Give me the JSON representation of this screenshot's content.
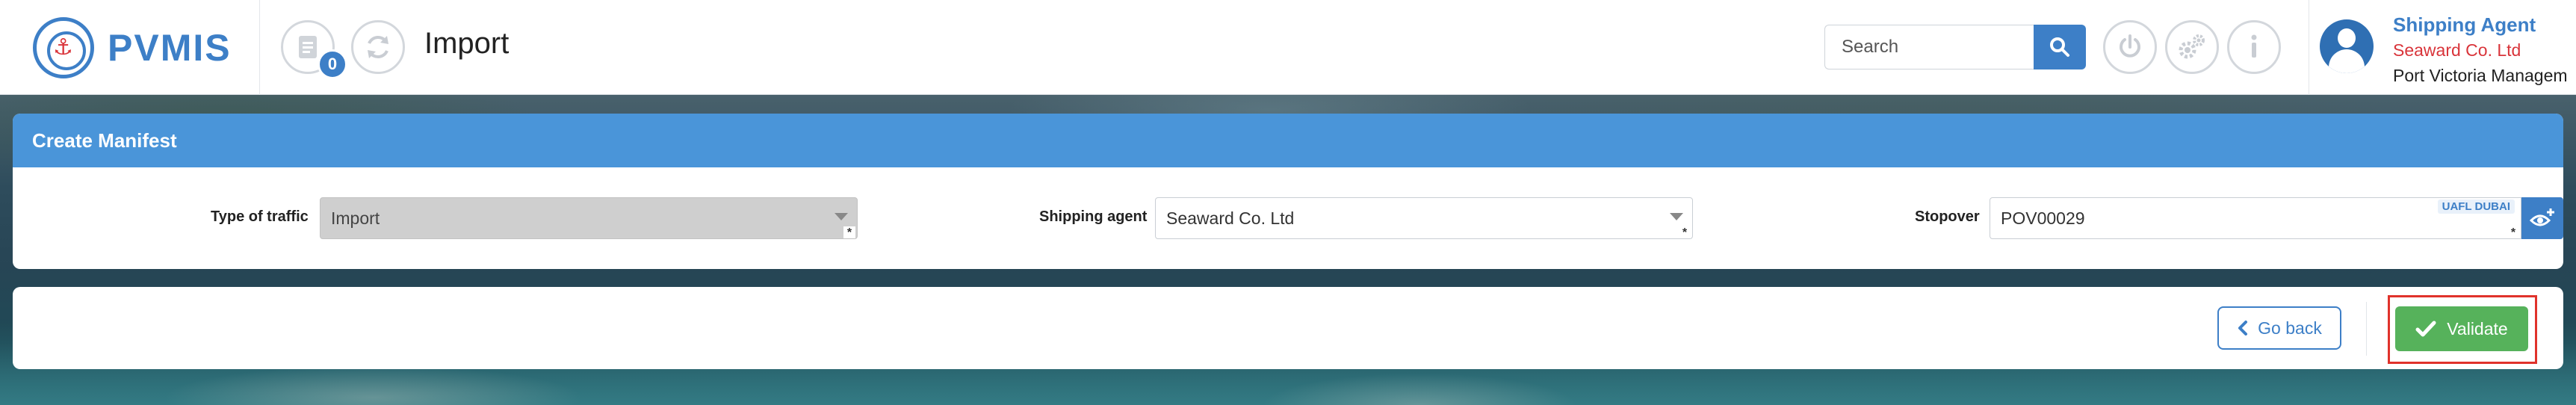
{
  "app": {
    "brand": "PVMIS",
    "notification_count": "0",
    "page_title": "Import"
  },
  "search": {
    "placeholder": "Search"
  },
  "user": {
    "role": "Shipping Agent",
    "company": "Seaward Co. Ltd",
    "organization": "Port Victoria Managem"
  },
  "form": {
    "title": "Create Manifest",
    "type_of_traffic_label": "Type of traffic",
    "type_of_traffic_value": "Import",
    "shipping_agent_label": "Shipping agent",
    "shipping_agent_value": "Seaward Co. Ltd",
    "stopover_label": "Stopover",
    "stopover_value": "POV00029",
    "stopover_tag": "UAFL DUBAI",
    "required_marker": "*"
  },
  "actions": {
    "go_back_label": "Go back",
    "validate_label": "Validate"
  },
  "colors": {
    "primary": "#3d7fc7",
    "header_bar": "#4a95d9",
    "validate": "#56b25b",
    "highlight": "#e0322b",
    "accent_red": "#d9343a"
  },
  "icons": {
    "logo": "pvmis-anchor-logo",
    "notifications": "document-icon",
    "refresh": "refresh-icon",
    "search": "search-icon",
    "power": "power-icon",
    "settings": "gears-icon",
    "info": "info-icon",
    "stopover_view": "eye-plus-icon",
    "back": "chevron-left-icon",
    "validate": "check-icon"
  }
}
